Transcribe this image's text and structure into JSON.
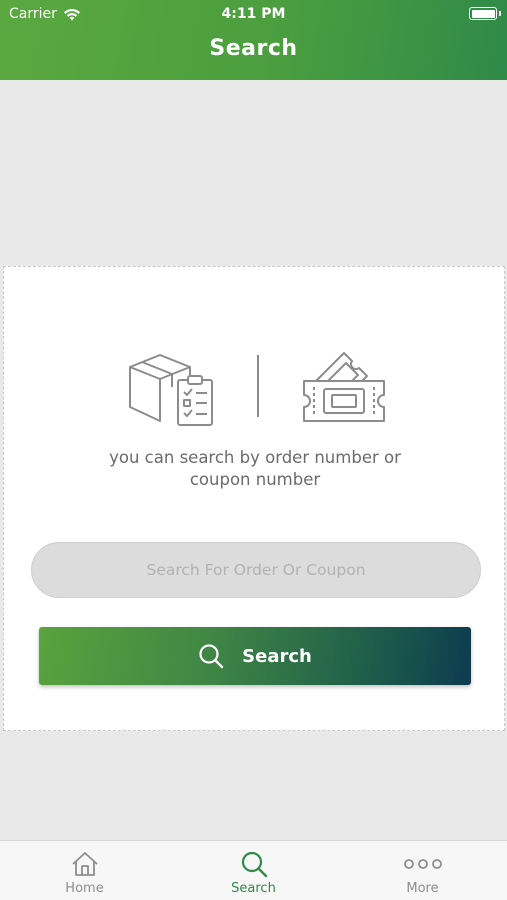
{
  "status_bar": {
    "carrier": "Carrier",
    "time": "4:11 PM",
    "battery_level": 1.0
  },
  "nav": {
    "title": "Search"
  },
  "card": {
    "illustrations": [
      "package-checklist-icon",
      "coupon-ticket-icon"
    ],
    "hint_line1": "you can search by order number or",
    "hint_line2": "coupon number",
    "search_placeholder": "Search For Order Or Coupon",
    "search_value": "",
    "search_button_label": "Search"
  },
  "tabbar": {
    "items": [
      {
        "label": "Home",
        "icon": "home-icon",
        "active": false
      },
      {
        "label": "Search",
        "icon": "search-icon",
        "active": true
      },
      {
        "label": "More",
        "icon": "more-icon",
        "active": false
      }
    ]
  },
  "colors": {
    "header_green": "#4b9e3f",
    "active_tab": "#2f8a49",
    "button_start": "#5aa33d",
    "button_end": "#0d3b50",
    "background": "#e9e9e9"
  }
}
